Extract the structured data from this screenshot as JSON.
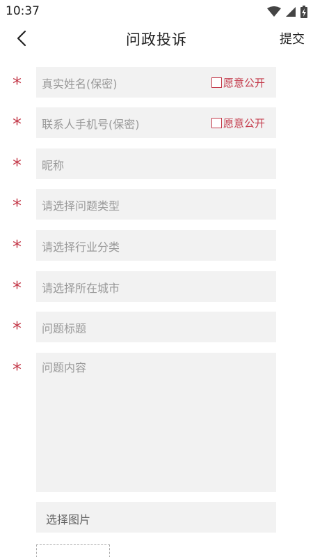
{
  "status_bar": {
    "time": "10:37"
  },
  "header": {
    "title": "问政投诉",
    "submit_label": "提交",
    "back_icon": "chevron-left-icon"
  },
  "required_mark": "*",
  "form": {
    "real_name": {
      "placeholder": "真实姓名(保密)",
      "public_label": "愿意公开"
    },
    "phone": {
      "placeholder": "联系人手机号(保密)",
      "public_label": "愿意公开"
    },
    "nickname": {
      "placeholder": "昵称"
    },
    "issue_type": {
      "placeholder": "请选择问题类型"
    },
    "industry": {
      "placeholder": "请选择行业分类"
    },
    "city": {
      "placeholder": "请选择所在城市"
    },
    "issue_title": {
      "placeholder": "问题标题"
    },
    "issue_content": {
      "placeholder": "问题内容"
    },
    "images": {
      "label": "选择图片"
    }
  },
  "colors": {
    "accent": "#c43b4b",
    "field_bg": "#f2f2f2",
    "placeholder": "#999999"
  }
}
